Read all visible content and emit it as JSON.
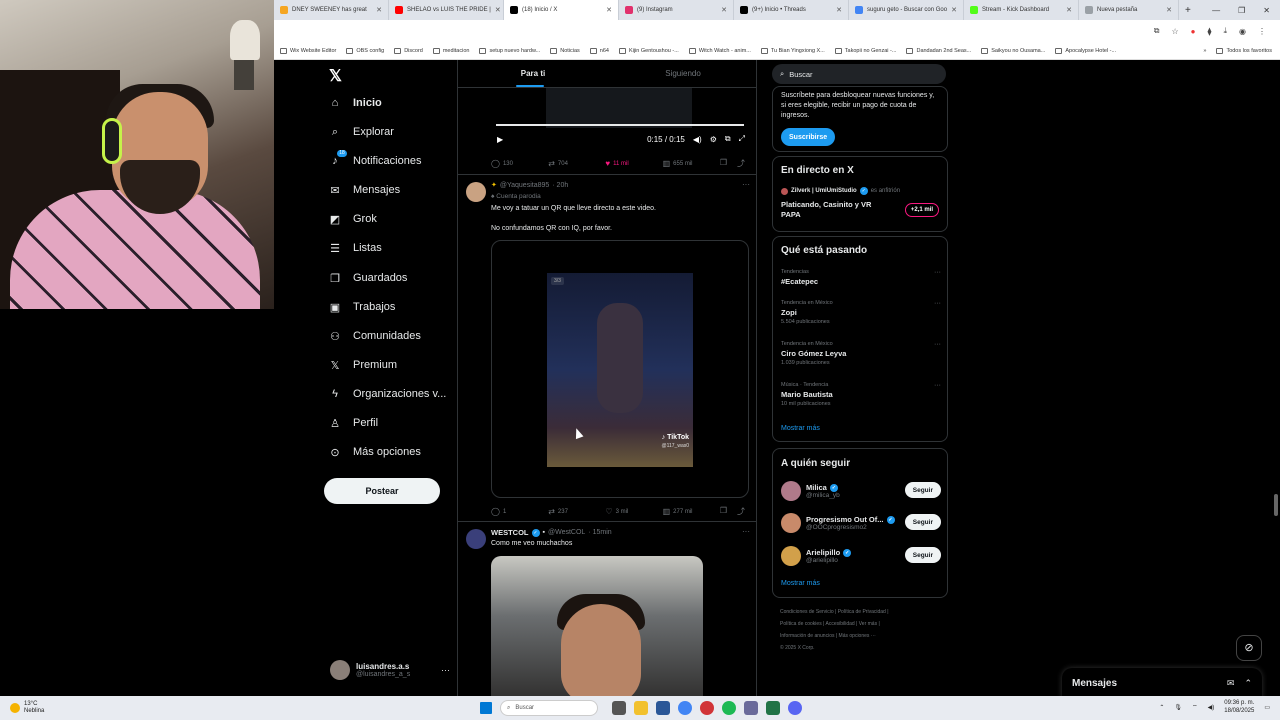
{
  "browser": {
    "tabs": [
      {
        "label": "DNEY SWEENEY has great",
        "color": "#f5a623",
        "active": false
      },
      {
        "label": "SHELAO vs LUIS THE PRIDE |",
        "color": "#ff0000",
        "active": false
      },
      {
        "label": "(18) Inicio / X",
        "color": "#000000",
        "active": true
      },
      {
        "label": "(9) Instagram",
        "color": "#e1306c",
        "active": false
      },
      {
        "label": "(9+) Inicio • Threads",
        "color": "#000000",
        "active": false
      },
      {
        "label": "suguru geto - Buscar con Goo",
        "color": "#4285f4",
        "active": false
      },
      {
        "label": "Stream - Kick Dashboard",
        "color": "#53fc18",
        "active": false
      },
      {
        "label": "Nueva pestaña",
        "color": "#9aa0a6",
        "active": false
      }
    ],
    "bookmarks": [
      "Wix Website Editor",
      "OBS config",
      "Discord",
      "meditacion",
      "setup nuevo hardw...",
      "Noticias",
      "n64",
      "Kijin Gentoushou -...",
      "Witch Watch - anim...",
      "Tu Bian Yingxiong X...",
      "Takopii no Genzai -...",
      "Dandadan 2nd Seas...",
      "Saikyou no Ousama...",
      "Apocalypse Hotel -..."
    ],
    "bookmarks_more": "»",
    "all_bookmarks": "Todos los favoritos"
  },
  "nav": {
    "items": [
      {
        "label": "Inicio",
        "icon": "⌂",
        "name": "home"
      },
      {
        "label": "Explorar",
        "icon": "⌕",
        "name": "explore"
      },
      {
        "label": "Notificaciones",
        "icon": "♪",
        "name": "notifications"
      },
      {
        "label": "Mensajes",
        "icon": "✉",
        "name": "messages"
      },
      {
        "label": "Grok",
        "icon": "◩",
        "name": "grok"
      },
      {
        "label": "Listas",
        "icon": "☰",
        "name": "lists"
      },
      {
        "label": "Guardados",
        "icon": "❐",
        "name": "bookmarks"
      },
      {
        "label": "Trabajos",
        "icon": "▣",
        "name": "jobs"
      },
      {
        "label": "Comunidades",
        "icon": "⚇",
        "name": "communities"
      },
      {
        "label": "Premium",
        "icon": "X",
        "name": "premium"
      },
      {
        "label": "Organizaciones v...",
        "icon": "ϟ",
        "name": "organizations"
      },
      {
        "label": "Perfil",
        "icon": "♙",
        "name": "profile"
      },
      {
        "label": "Más opciones",
        "icon": "⊙",
        "name": "more-options"
      }
    ],
    "notif_badge": "18",
    "post_label": "Postear",
    "account": {
      "name": "luisandres.a.s",
      "handle": "@luisandres_a_s"
    }
  },
  "timeline": {
    "tabs": [
      "Para ti",
      "Siguiendo"
    ],
    "video1": {
      "time": "0:15 / 0:15"
    },
    "actions1": {
      "replies": "130",
      "reposts": "704",
      "likes": "11 mil",
      "views": "655 mil"
    },
    "post2": {
      "handle": "@Yaquesita895",
      "time": "· 20h",
      "label": "Cuenta parodia",
      "line1": "Me voy a tatuar un QR que lleve directo a este video.",
      "line2": "No confundamos QR con IQ, por favor.",
      "badge": "3/3",
      "watermark": "TikTok",
      "watermark_handle": "@117_was0"
    },
    "actions2": {
      "replies": "1",
      "reposts": "237",
      "likes": "3 mil",
      "views": "277 mil"
    },
    "post3": {
      "name": "WESTCOL",
      "handle": "@WestCOL",
      "time": "· 15min",
      "text": "Como me veo muchachos"
    }
  },
  "right": {
    "search_placeholder": "Buscar",
    "subscribe": {
      "text": "Suscríbete para desbloquear nuevas funciones y, si eres elegible, recibir un pago de cuota de ingresos.",
      "button": "Suscribirse"
    },
    "live": {
      "title": "En directo en X",
      "host": "Zilverk | UmiUmiStudio",
      "host_role": "es anfitrión",
      "stream_title": "Platicando, Casinito y VR PAPA",
      "count": "+2,1 mil"
    },
    "trends": {
      "title": "Qué está pasando",
      "items": [
        {
          "context": "Tendencias",
          "name": "#Ecatepec",
          "posts": ""
        },
        {
          "context": "Tendencia en México",
          "name": "Zopi",
          "posts": "5.504 publicaciones"
        },
        {
          "context": "Tendencia en México",
          "name": "Ciro Gómez Leyva",
          "posts": "1.039 publicaciones"
        },
        {
          "context": "Música · Tendencia",
          "name": "Mario Bautista",
          "posts": "10 mil publicaciones"
        }
      ],
      "show_more": "Mostrar más"
    },
    "who_to_follow": {
      "title": "A quién seguir",
      "items": [
        {
          "name": "Milica",
          "handle": "@milica_yb",
          "color": "#b07a8a"
        },
        {
          "name": "Progresismo Out Of...",
          "handle": "@OOCprogresismo2",
          "color": "#c88a6a"
        },
        {
          "name": "Arielipillo",
          "handle": "@arielipillo",
          "color": "#d2a04a"
        }
      ],
      "follow_label": "Seguir",
      "show_more": "Mostrar más"
    },
    "footer": {
      "line1": "Condiciones de Servicio | Política de Privacidad |",
      "line2": "Política de cookies | Accesibilidad | Ver más |",
      "line3": "Información de anuncios | Más opciones ···",
      "line4": "© 2025 X Corp."
    }
  },
  "messages_drawer": {
    "title": "Mensajes"
  },
  "taskbar": {
    "temp": "13°C",
    "weather": "Neblina",
    "search": "Buscar",
    "time": "09:36 p. m.",
    "date": "18/08/2025"
  }
}
